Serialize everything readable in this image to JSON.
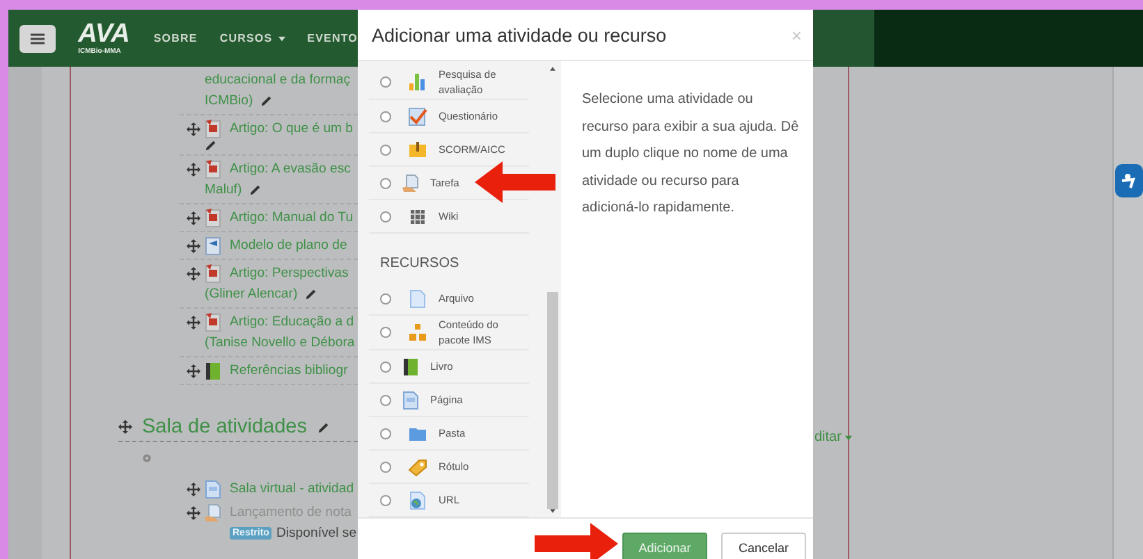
{
  "navbar": {
    "logo": {
      "text": "AVA",
      "subtext": "ICMBio-MMA"
    },
    "links": [
      {
        "label": "SOBRE",
        "dropdown": false
      },
      {
        "label": "CURSOS",
        "dropdown": true
      },
      {
        "label": "EVENTO",
        "dropdown": false
      }
    ]
  },
  "course": {
    "items": [
      {
        "kind": "fragment",
        "lines": [
          "educacional e da formaç",
          "ICMBio)"
        ],
        "editable": true
      },
      {
        "kind": "pdf",
        "lines": [
          "Artigo: O que é um b"
        ],
        "editable": true
      },
      {
        "kind": "pdf",
        "lines": [
          "Artigo: A evasão esc",
          "Maluf)"
        ],
        "editable": true
      },
      {
        "kind": "pdf",
        "lines": [
          "Artigo: Manual do Tu"
        ],
        "editable": false
      },
      {
        "kind": "doc",
        "lines": [
          "Modelo de plano de"
        ],
        "editable": false
      },
      {
        "kind": "pdf",
        "lines": [
          "Artigo: Perspectivas",
          "(Gliner Alencar)"
        ],
        "editable": true
      },
      {
        "kind": "pdf",
        "lines": [
          "Artigo: Educação a d",
          "(Tanise Novello e Débora"
        ],
        "editable": false
      },
      {
        "kind": "book",
        "lines": [
          "Referências bibliogr"
        ],
        "editable": false
      }
    ],
    "section": {
      "title": "Sala de atividades",
      "menu_label": "ditar",
      "items": [
        {
          "kind": "page",
          "lines": [
            "Sala virtual - atividad"
          ],
          "dimmed": false
        },
        {
          "kind": "assign",
          "lines": [
            "Lançamento de nota"
          ],
          "dimmed": true,
          "badge": "Restrito",
          "note": "Disponível se"
        }
      ]
    }
  },
  "modal": {
    "title": "Adicionar uma atividade ou recurso",
    "close": "×",
    "groups": [
      {
        "options": [
          {
            "label": "Pesquisa de avaliação",
            "kind": "chart",
            "selected": false,
            "pointer": false
          },
          {
            "label": "Questionário",
            "kind": "quiz",
            "selected": false,
            "pointer": false
          },
          {
            "label": "SCORM/AICC",
            "kind": "scorm",
            "selected": false,
            "pointer": false
          },
          {
            "label": "Tarefa",
            "kind": "assign",
            "selected": false,
            "pointer": true
          },
          {
            "label": "Wiki",
            "kind": "wiki",
            "selected": false,
            "pointer": false
          }
        ]
      },
      {
        "heading": "RECURSOS",
        "options": [
          {
            "label": "Arquivo",
            "kind": "file",
            "selected": false,
            "pointer": false
          },
          {
            "label": "Conteúdo do pacote IMS",
            "kind": "ims",
            "selected": false,
            "pointer": false
          },
          {
            "label": "Livro",
            "kind": "book",
            "selected": false,
            "pointer": false
          },
          {
            "label": "Página",
            "kind": "page",
            "selected": false,
            "pointer": false
          },
          {
            "label": "Pasta",
            "kind": "folder",
            "selected": false,
            "pointer": false
          },
          {
            "label": "Rótulo",
            "kind": "label",
            "selected": false,
            "pointer": false
          },
          {
            "label": "URL",
            "kind": "url",
            "selected": false,
            "pointer": false
          }
        ]
      }
    ],
    "help": "Selecione uma atividade ou recurso para exibir a sua ajuda. Dê um duplo clique no nome de uma atividade ou recurso para adicioná-lo rapidamente.",
    "buttons": [
      {
        "label": "Adicionar",
        "kind": "primary",
        "pointer": true
      },
      {
        "label": "Cancelar",
        "kind": "secondary",
        "pointer": false
      }
    ]
  }
}
